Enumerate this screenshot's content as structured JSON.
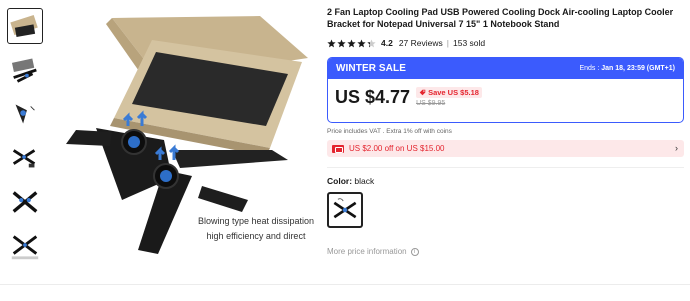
{
  "product": {
    "title": "2 Fan Laptop Cooling Pad USB Powered Cooling Dock Air-cooling Laptop Cooler Bracket for Notepad Universal 7 15\" 1 Notebook Stand",
    "rating": "4.2",
    "reviews": "27 Reviews",
    "sold": "153 sold",
    "stars_filled": 4
  },
  "gallery": {
    "caption_line1": "Blowing type heat dissipation",
    "caption_line2": "high efficiency and direct",
    "thumb_count": 6
  },
  "sale": {
    "label": "WINTER SALE",
    "ends_prefix": "Ends :",
    "ends_value": "Jan 18, 23:59 (GMT+1)",
    "price": "US $4.77",
    "save": "Save US $5.18",
    "original_price": "US $9.95"
  },
  "vat_note": "Price includes VAT . Extra 1% off with coins",
  "coupon": {
    "text": "US $2.00 off on US $15.00",
    "arrow": "›"
  },
  "color": {
    "label": "Color:",
    "value": "black"
  },
  "more_info": "More price information",
  "colors": {
    "accent": "#3b5bfd",
    "sale_red": "#e4252f",
    "star": "#191919"
  }
}
